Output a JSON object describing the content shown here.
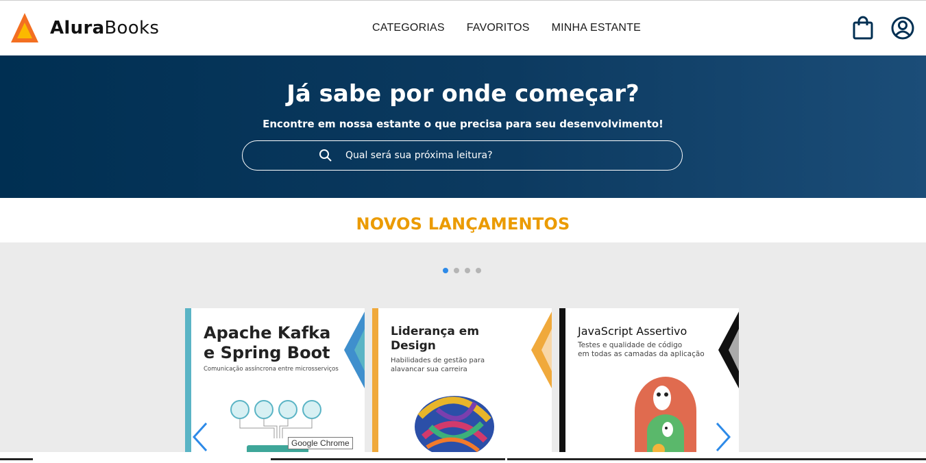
{
  "header": {
    "logo_bold": "Alura",
    "logo_regular": "Books",
    "nav": [
      "CATEGORIAS",
      "FAVORITOS",
      "MINHA ESTANTE"
    ],
    "icons": [
      "shopping-bag-icon",
      "user-icon"
    ]
  },
  "hero": {
    "title": "Já sabe por onde começar?",
    "subtitle": "Encontre em nossa estante o que precisa para seu desenvolvimento!",
    "search_placeholder": "Qual será sua próxima leitura?"
  },
  "section": {
    "title": "NOVOS LANÇAMENTOS"
  },
  "carousel": {
    "slide_count": 4,
    "active_index": 0,
    "books": [
      {
        "title_line1": "Apache Kafka",
        "title_line2": "e Spring Boot",
        "subtitle_line1": "Comunicação assíncrona entre microsserviços",
        "subtitle_line2": "",
        "accent": "#5ab4c5"
      },
      {
        "title_line1": "Liderança em",
        "title_line2": "Design",
        "subtitle_line1": "Habilidades de gestão para",
        "subtitle_line2": "alavancar sua carreira",
        "accent": "#f0a93b"
      },
      {
        "title_line1": "JavaScript Assertivo",
        "title_line2": "",
        "subtitle_line1": "Testes e qualidade de código",
        "subtitle_line2": "em todas as camadas da aplicação",
        "accent": "#111111"
      }
    ]
  },
  "tooltip": "Google Chrome",
  "colors": {
    "brand_orange": "#eb9b00",
    "hero_blue": "#002f52",
    "icon_blue": "#0c3a60",
    "link_blue": "#2d8ae8"
  }
}
